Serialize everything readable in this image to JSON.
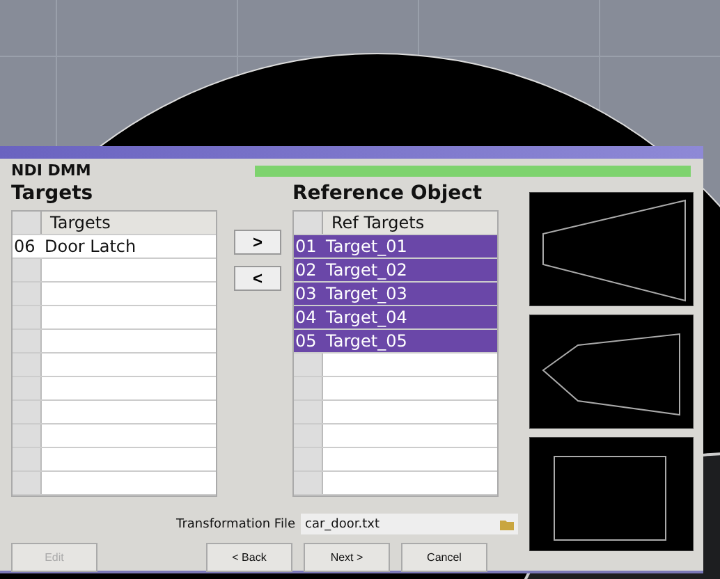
{
  "app": {
    "name": "NDI DMM"
  },
  "targets": {
    "heading": "Targets",
    "column": "Targets",
    "rows": [
      {
        "index": "06",
        "name": "Door Latch"
      }
    ]
  },
  "move_buttons": [
    ">",
    "<"
  ],
  "reference": {
    "heading": "Reference Object",
    "column": "Ref Targets",
    "rows": [
      {
        "index": "01",
        "name": "Target_01",
        "selected": true
      },
      {
        "index": "02",
        "name": "Target_02",
        "selected": true
      },
      {
        "index": "03",
        "name": "Target_03",
        "selected": true
      },
      {
        "index": "04",
        "name": "Target_04",
        "selected": true
      },
      {
        "index": "05",
        "name": "Target_05",
        "selected": true
      }
    ]
  },
  "transformation_file": {
    "label": "Transformation File",
    "value": "car_door.txt"
  },
  "buttons": [
    {
      "label": "Edit",
      "disabled": true
    },
    {
      "label": "< Back",
      "disabled": false
    },
    {
      "label": "Next >",
      "disabled": false
    },
    {
      "label": "Cancel",
      "disabled": false
    }
  ]
}
